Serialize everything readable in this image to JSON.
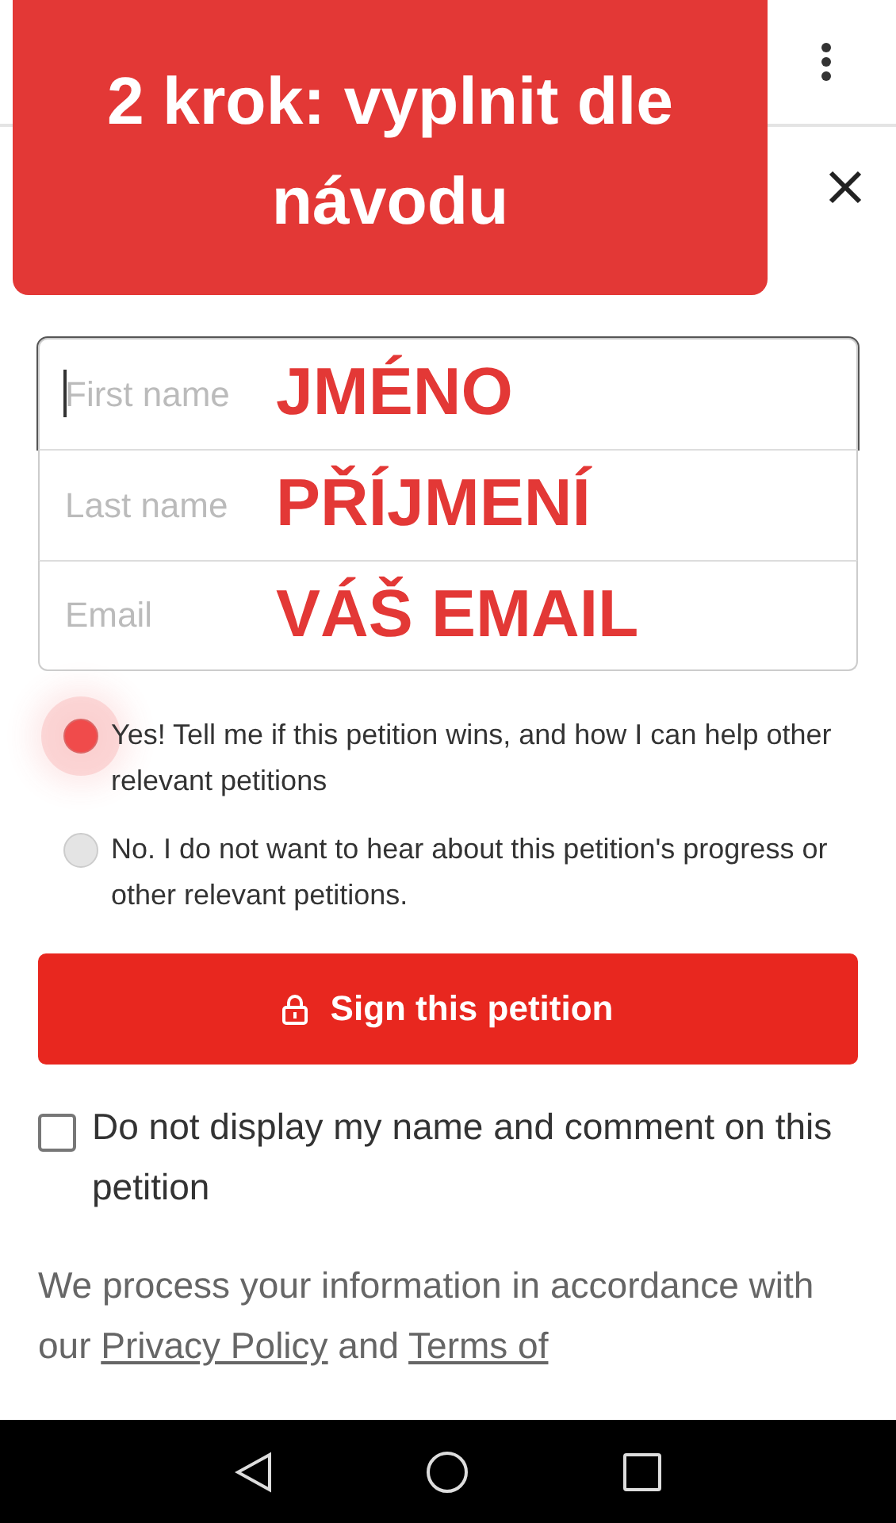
{
  "annotation": {
    "title": "2 krok: vyplnit dle návodu"
  },
  "fields": [
    {
      "placeholder": "First name",
      "note": "JMÉNO",
      "focused": true
    },
    {
      "placeholder": "Last name",
      "note": "PŘÍJMENÍ",
      "focused": false
    },
    {
      "placeholder": "Email",
      "note": "VÁŠ EMAIL",
      "focused": false
    }
  ],
  "options": [
    {
      "label": "Yes! Tell me if this petition wins, and how I can help other relevant petitions",
      "selected": true
    },
    {
      "label": "No. I do not want to hear about this petition's progress or other relevant petitions.",
      "selected": false
    }
  ],
  "sign_button": {
    "label": "Sign this petition"
  },
  "hide_name": {
    "label": "Do not display my name and comment on this petition",
    "checked": false
  },
  "privacy": {
    "before": "We process your information in accordance with our",
    "link_1": "Privacy Policy",
    "middle": "and",
    "link_2": "Terms of"
  }
}
